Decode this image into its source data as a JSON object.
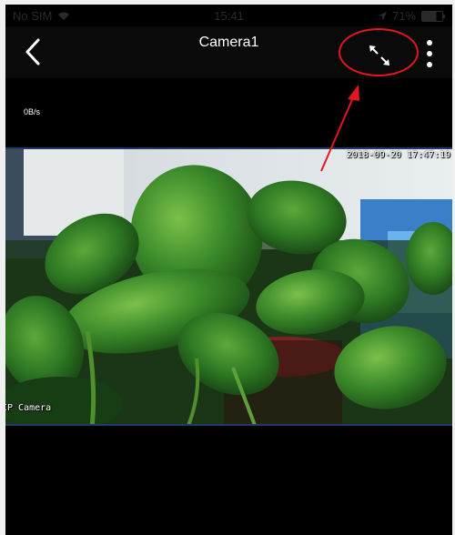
{
  "status_bar": {
    "carrier": "No SIM",
    "time": "15:41",
    "battery": "71%"
  },
  "nav": {
    "title": "Camera1",
    "back_icon": "chevron-left-icon",
    "fullscreen_icon": "expand-arrows-icon",
    "more_icon": "more-vertical-icon"
  },
  "stream": {
    "speed": "0B/s"
  },
  "video": {
    "osd_timestamp": "2018-09-20 17:47:19",
    "osd_name": "IP Camera"
  },
  "colors": {
    "accent": "#e5161d",
    "background": "#000000",
    "video_border": "#1f3a6b"
  }
}
